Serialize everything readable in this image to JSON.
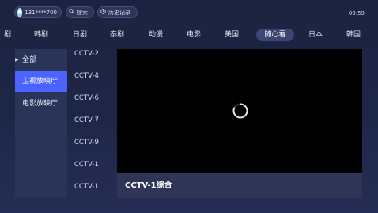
{
  "header": {
    "account": "131****700",
    "search_label": "搜索",
    "history_label": "历史记录",
    "time": "09:59"
  },
  "tabs": [
    "剧",
    "韩剧",
    "日剧",
    "泰剧",
    "动漫",
    "电影",
    "美国",
    "随心看",
    "日本",
    "韩国"
  ],
  "active_tab": "随心看",
  "categories": [
    "全部",
    "卫视放映厅",
    "电影放映厅"
  ],
  "active_category": "卫视放映厅",
  "channels": [
    "CCTV-2",
    "CCTV-4",
    "CCTV-6",
    "CCTV-7",
    "CCTV-9",
    "CCTV-1",
    "CCTV-1"
  ],
  "player": {
    "status": "loading",
    "now_playing": "CCTV-1综合"
  },
  "colors": {
    "background": "#1e2648",
    "panel": "#2a3358",
    "active_category": "#4b63ff",
    "active_tab": "#3c4672",
    "player": "#000000"
  }
}
